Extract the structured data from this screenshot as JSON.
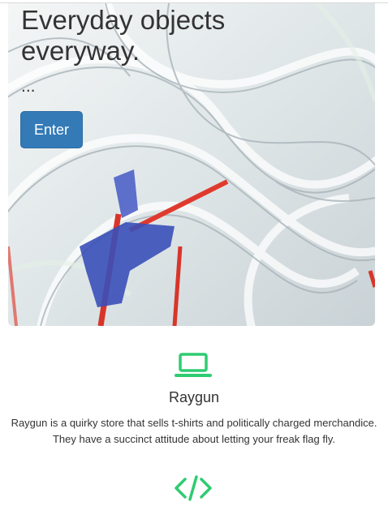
{
  "hero": {
    "title": "Everyday objects everyway.",
    "subtitle": "...",
    "enter_label": "Enter"
  },
  "features": [
    {
      "icon": "laptop-icon",
      "title": "Raygun",
      "description": "Raygun is a quirky store that sells t-shirts and politically charged merchandice. They have a succinct attitude about letting your freak flag fly."
    },
    {
      "icon": "code-icon"
    }
  ],
  "colors": {
    "accent_icon": "#2ecc71",
    "button_bg": "#337ab7"
  }
}
